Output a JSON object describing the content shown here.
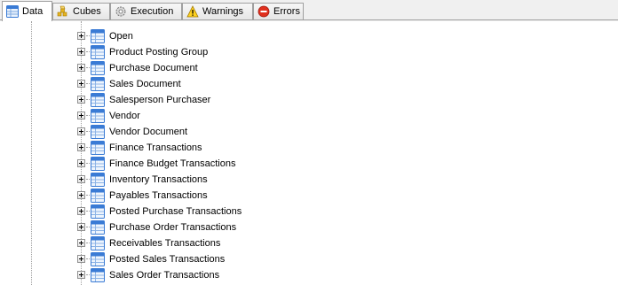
{
  "tabs": [
    {
      "label": "Data",
      "icon": "data-grid-icon",
      "active": true
    },
    {
      "label": "Cubes",
      "icon": "cubes-icon",
      "active": false
    },
    {
      "label": "Execution",
      "icon": "gear-icon",
      "active": false
    },
    {
      "label": "Warnings",
      "icon": "warning-icon",
      "active": false
    },
    {
      "label": "Errors",
      "icon": "error-icon",
      "active": false
    }
  ],
  "tree": {
    "items": [
      {
        "label": "Open"
      },
      {
        "label": "Product Posting Group"
      },
      {
        "label": "Purchase Document"
      },
      {
        "label": "Sales Document"
      },
      {
        "label": "Salesperson Purchaser"
      },
      {
        "label": "Vendor"
      },
      {
        "label": "Vendor Document"
      },
      {
        "label": "Finance Transactions"
      },
      {
        "label": "Finance Budget Transactions"
      },
      {
        "label": "Inventory Transactions"
      },
      {
        "label": "Payables Transactions"
      },
      {
        "label": "Posted Purchase Transactions"
      },
      {
        "label": "Purchase Order Transactions"
      },
      {
        "label": "Receivables Transactions"
      },
      {
        "label": "Posted Sales Transactions"
      },
      {
        "label": "Sales Order Transactions"
      }
    ]
  },
  "colors": {
    "tab_border": "#a0a0a0",
    "table_icon_blue": "#3a7bd5",
    "tree_line": "#a0a0a0"
  }
}
